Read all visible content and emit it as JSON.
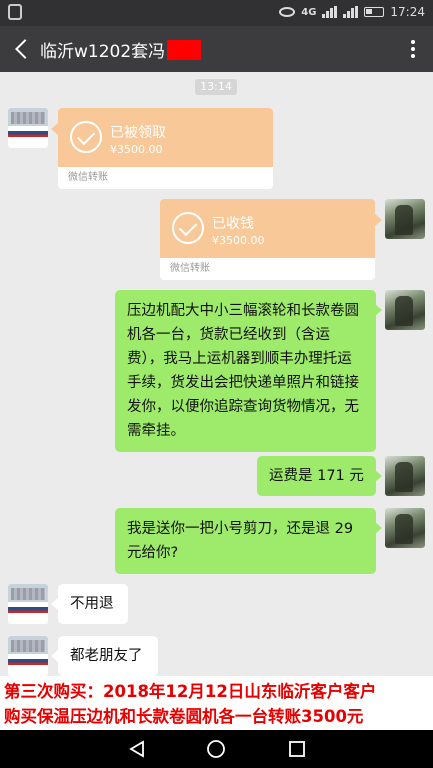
{
  "status_bar": {
    "signal_label": "4G",
    "time": "17:24"
  },
  "chat": {
    "title": "临沂w1202套冯",
    "back_icon": "chevron-left-icon",
    "more_icon": "more-vertical-icon",
    "timestamp": "13:14"
  },
  "messages": {
    "transfer_received_by_other": {
      "status": "已被领取",
      "amount": "¥3500.00",
      "label": "微信转账"
    },
    "transfer_received_by_me": {
      "status": "已收钱",
      "amount": "¥3500.00",
      "label": "微信转账"
    },
    "msg1": "压边机配大中小三幅滚轮和长款卷圆机各一台，货款已经收到（含运费），我马上运机器到顺丰办理托运手续，货发出会把快递单照片和链接发你，以便你追踪查询货物情况，无需牵挂。",
    "msg2": "运费是 171 元",
    "msg3": "我是送你一把小号剪刀，还是退 29 元给你?",
    "msg4": "不用退",
    "msg5": "都老朋友了"
  },
  "caption": {
    "line1": "第三次购买：2018年12月12日山东临沂客户客户",
    "line2": "购买保温压边机和长款卷圆机各一台转账3500元"
  },
  "colors": {
    "my_bubble": "#9eea6a",
    "transfer_card": "#f8c898",
    "caption_text": "#e60000"
  }
}
